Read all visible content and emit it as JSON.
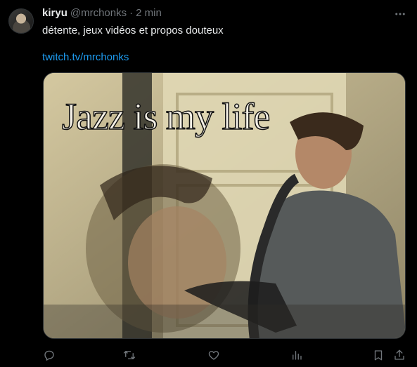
{
  "author": {
    "display_name": "kiryu",
    "handle": "@mrchonks",
    "separator": "·",
    "time": "2 min"
  },
  "tweet": {
    "text": "détente, jeux vidéos et propos douteux",
    "link": "twitch.tv/mrchonks"
  },
  "media": {
    "overlay_text": "Jazz is my life"
  },
  "icons": {
    "more": "more-horizontal-icon",
    "reply": "reply-icon",
    "retweet": "retweet-icon",
    "like": "heart-icon",
    "views": "analytics-icon",
    "bookmark": "bookmark-icon",
    "share": "share-icon"
  },
  "colors": {
    "background": "#000000",
    "text": "#e7e9ea",
    "secondary": "#71767b",
    "link": "#1d9bf0"
  }
}
